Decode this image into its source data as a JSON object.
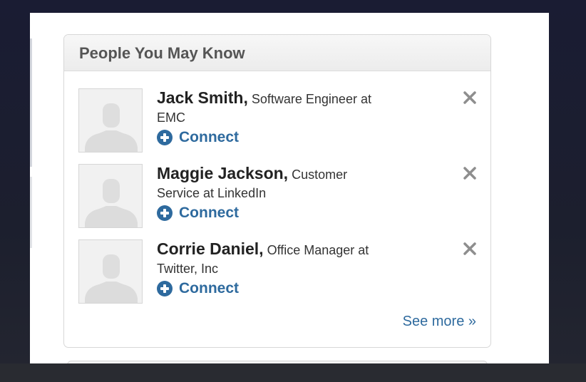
{
  "widget": {
    "title": "People You May Know",
    "see_more": "See more »",
    "people": [
      {
        "name": "Jack Smith,",
        "role_line1": "Software Engineer at",
        "role_line2": "EMC",
        "connect": "Connect"
      },
      {
        "name": "Maggie Jackson,",
        "role_line1": "Customer",
        "role_line2": "Service at LinkedIn",
        "connect": "Connect"
      },
      {
        "name": "Corrie Daniel,",
        "role_line1": "Office Manager at",
        "role_line2": "Twitter, Inc",
        "connect": "Connect"
      }
    ]
  },
  "icons": {
    "avatar": "default-person-silhouette",
    "dismiss": "close-x-icon",
    "connect": "plus-circle-icon"
  },
  "colors": {
    "link": "#2e6a9e",
    "name": "#222222",
    "title": "#555555",
    "background": "#1c1f2e"
  }
}
